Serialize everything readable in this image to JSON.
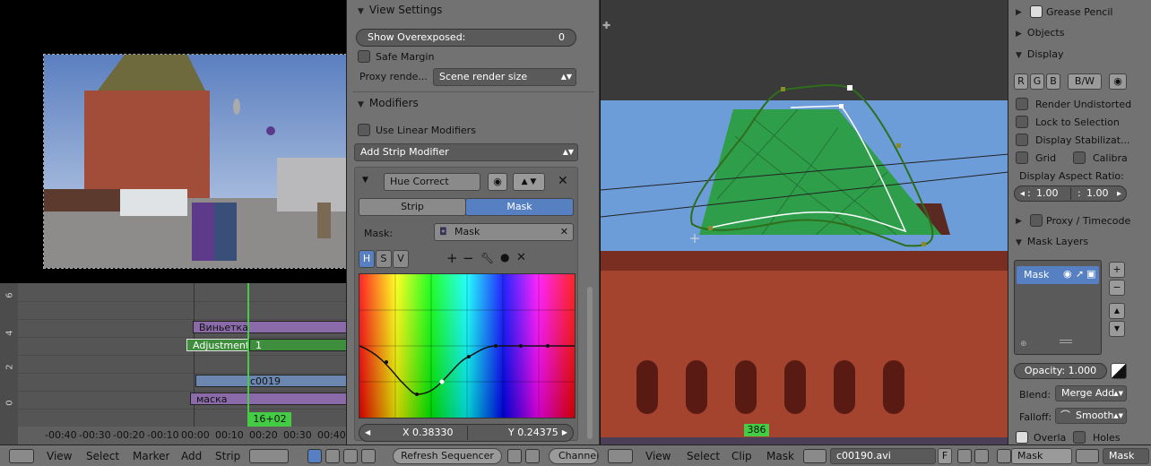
{
  "sequencer": {
    "ruler_left": [
      "6",
      "4",
      "2",
      "0"
    ],
    "time_labels": [
      "-00:40",
      "-00:30",
      "-00:20",
      "-00:10",
      "00:00",
      "00:10",
      "00:20",
      "00:30",
      "00:40"
    ],
    "playhead": "16+02",
    "strips": [
      "Виньетка",
      "Adjustment",
      "1",
      "c0019",
      "маска"
    ]
  },
  "view_settings": {
    "title": "View Settings",
    "show_overexposed_label": "Show Overexposed:",
    "show_overexposed_value": "0",
    "safe_margin": "Safe Margin",
    "proxy_label": "Proxy rende...",
    "proxy_value": "Scene render size"
  },
  "modifiers": {
    "title": "Modifiers",
    "use_linear": "Use Linear Modifiers",
    "add_strip_modifier": "Add Strip Modifier",
    "modifier_name": "Hue Correct",
    "tab_strip": "Strip",
    "tab_mask": "Mask",
    "mask_label": "Mask:",
    "mask_value": "Mask",
    "h": "H",
    "s": "S",
    "v": "V",
    "x_value": "X 0.38330",
    "y_value": "Y 0.24375"
  },
  "clip": {
    "frame": "386"
  },
  "sidebar": {
    "grease_pencil": "Grease Pencil",
    "objects": "Objects",
    "display": "Display",
    "r": "R",
    "g": "G",
    "b": "B",
    "bw": "B/W",
    "render_undistorted": "Render Undistorted",
    "lock_to_selection": "Lock to Selection",
    "display_stabilization": "Display Stabilizat...",
    "grid": "Grid",
    "calibra": "Calibra",
    "aspect_label": "Display Aspect Ratio:",
    "aspect_x": "1.00",
    "aspect_y": "1.00",
    "proxy_timecode": "Proxy / Timecode",
    "mask_layers": "Mask Layers",
    "mask_item": "Mask",
    "opacity": "Opacity: 1.000",
    "blend_label": "Blend:",
    "blend_value": "Merge Add",
    "falloff_label": "Falloff:",
    "falloff_value": "Smooth",
    "overlay": "Overla",
    "holes": "Holes"
  },
  "bottom_bar": {
    "left_menus": [
      "View",
      "Select",
      "Marker",
      "Add",
      "Strip"
    ],
    "refresh": "Refresh Sequencer",
    "channel": "Channel:",
    "right_menus": [
      "View",
      "Select",
      "Clip",
      "Mask"
    ],
    "clip_name": "c00190.avi",
    "f_label": "F",
    "mask_mode": "Mask",
    "mask_name": "Mask"
  },
  "colors": {
    "selected_blue": "#5680c2",
    "strip_purple": "#8a6aa8",
    "strip_green": "#3e8e3e",
    "strip_blue": "#6b87b0",
    "playhead_green": "#44cc44"
  }
}
